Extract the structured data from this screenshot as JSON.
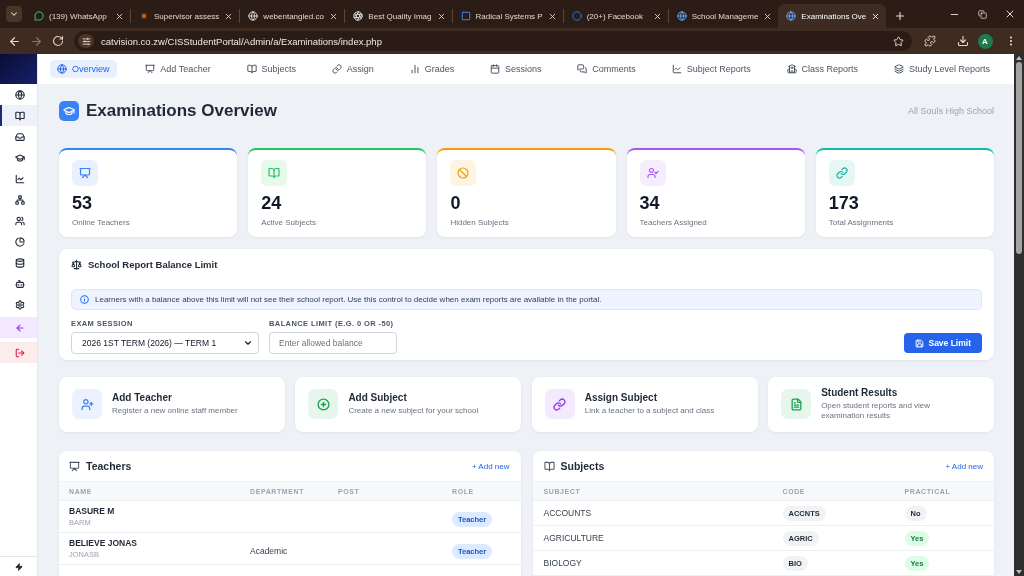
{
  "browser": {
    "tabs": [
      {
        "title": "(139) WhatsApp",
        "selected": false
      },
      {
        "title": "Supervisor assess",
        "selected": false
      },
      {
        "title": "webentangled.co",
        "selected": false
      },
      {
        "title": "Best Quality Imag",
        "selected": false
      },
      {
        "title": "Radical Systems P",
        "selected": false
      },
      {
        "title": "(20+) Facebook",
        "selected": false
      },
      {
        "title": "School Manageme",
        "selected": false
      },
      {
        "title": "Examinations Ove",
        "selected": true
      }
    ],
    "address": "catvision.co.zw/CISStudentPortal/Admin/a/Examinations/index.php",
    "profile": "A"
  },
  "sidebar": {
    "items": [
      {
        "kind": "nav",
        "selected": false
      },
      {
        "kind": "nav",
        "selected": true
      },
      {
        "kind": "nav",
        "selected": false
      },
      {
        "kind": "nav",
        "selected": false
      },
      {
        "kind": "nav",
        "selected": false
      },
      {
        "kind": "nav",
        "selected": false
      },
      {
        "kind": "nav",
        "selected": false
      },
      {
        "kind": "nav",
        "selected": false
      },
      {
        "kind": "nav",
        "selected": false
      },
      {
        "kind": "nav",
        "selected": false
      },
      {
        "kind": "nav",
        "selected": false
      },
      {
        "kind": "back",
        "selected": false
      },
      {
        "kind": "logout",
        "selected": false
      }
    ]
  },
  "nav": {
    "items": [
      {
        "label": "Overview",
        "selected": true
      },
      {
        "label": "Add Teacher",
        "selected": false
      },
      {
        "label": "Subjects",
        "selected": false
      },
      {
        "label": "Assign",
        "selected": false
      },
      {
        "label": "Grades",
        "selected": false
      },
      {
        "label": "Sessions",
        "selected": false
      },
      {
        "label": "Comments",
        "selected": false
      },
      {
        "label": "Subject Reports",
        "selected": false
      },
      {
        "label": "Class Reports",
        "selected": false
      },
      {
        "label": "Study Level Reports",
        "selected": false
      }
    ]
  },
  "header": {
    "title": "Examinations Overview",
    "school": "All Souls High School"
  },
  "stats": [
    {
      "value": "53",
      "label": "Online Teachers",
      "color": "#3b82f6"
    },
    {
      "value": "24",
      "label": "Active Subjects",
      "color": "#22c55e"
    },
    {
      "value": "0",
      "label": "Hidden Subjects",
      "color": "#f59e0b"
    },
    {
      "value": "34",
      "label": "Teachers Assigned",
      "color": "#a855f7"
    },
    {
      "value": "173",
      "label": "Total Assignments",
      "color": "#14b8a6"
    }
  ],
  "balance_limit": {
    "title": "School Report Balance Limit",
    "notice": "Learners with a balance above this limit will not see their school report. Use this control to decide when exam reports are available in the portal.",
    "session_label": "EXAM SESSION",
    "session_value": "2026 1ST TERM (2026) — TERM 1",
    "limit_label": "BALANCE LIMIT (E.G. 0 OR -50)",
    "limit_placeholder": "Enter allowed balance",
    "save": "Save Limit"
  },
  "actions": [
    {
      "title": "Add Teacher",
      "subtitle": "Register a new online staff member",
      "color": "#3b82f6"
    },
    {
      "title": "Add Subject",
      "subtitle": "Create a new subject for your school",
      "color": "#16a34a"
    },
    {
      "title": "Assign Subject",
      "subtitle": "Link a teacher to a subject and class",
      "color": "#9333ea"
    },
    {
      "title": "Student Results",
      "subtitle": "Open student reports and view examination results",
      "color": "#16a34a"
    }
  ],
  "teachers": {
    "title": "Teachers",
    "add": "+ Add new",
    "columns": [
      "NAME",
      "DEPARTMENT",
      "POST",
      "ROLE"
    ],
    "rows": [
      {
        "name": "BASURE M",
        "username": "BARM",
        "role": "Teacher"
      },
      {
        "name": "BELIEVE JONAS",
        "username": "JONASB",
        "department": "Academic",
        "role": "Teacher"
      }
    ]
  },
  "subjects": {
    "title": "Subjects",
    "add": "+ Add new",
    "columns": [
      "SUBJECT",
      "CODE",
      "PRACTICAL"
    ],
    "rows": [
      {
        "subject": "ACCOUNTS",
        "code": "ACCNTS",
        "practical": "No",
        "practical_on": false
      },
      {
        "subject": "AGRICULTURE",
        "code": "AGRIC",
        "practical": "Yes",
        "practical_on": true
      },
      {
        "subject": "BIOLOGY",
        "code": "BIO",
        "practical": "Yes",
        "practical_on": true
      }
    ]
  }
}
